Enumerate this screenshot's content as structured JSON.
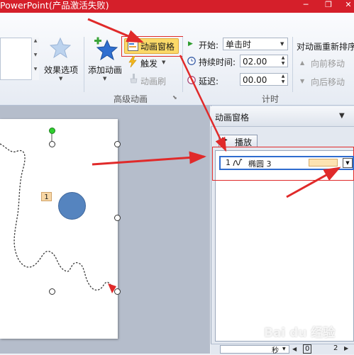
{
  "window": {
    "title": "PowerPoint(产品激活失败)",
    "minimize_glyph": "─",
    "restore_glyph": "❐",
    "close_glyph": "✕"
  },
  "ribbon": {
    "effect_options_label": "效果选项",
    "add_animation_label": "添加动画",
    "animation_pane_label": "动画窗格",
    "trigger_label": "触发",
    "animation_painter_label": "动画刷",
    "advanced_group_label": "高级动画",
    "start_label": "开始:",
    "start_value": "单击时",
    "duration_label": "持续时间:",
    "duration_value": "02.00",
    "delay_label": "延迟:",
    "delay_value": "00.00",
    "timing_group_label": "计时",
    "reorder_label": "对动画重新排序",
    "move_earlier_label": "向前移动",
    "move_later_label": "向后移动"
  },
  "slide": {
    "animation_tag": "1"
  },
  "pane": {
    "title": "动画窗格",
    "play_label": "播放",
    "items": [
      {
        "index": "1",
        "name": "椭圆 3"
      }
    ],
    "footer_seconds_label": "秒",
    "footer_ticks": [
      "0",
      "2"
    ]
  },
  "watermark": "Bai du 经验",
  "colors": {
    "title_bar": "#d51f2a",
    "highlight_button": "#fbd968",
    "annotation_red": "#e02a2a",
    "shape_fill": "#5584bf",
    "timing_bar": "#fde3b2",
    "selection_border": "#2f6ccf"
  },
  "icons": {
    "effect_options": "star-icon",
    "add_animation": "star-plus-icon",
    "animation_pane": "animation-pane-icon",
    "trigger": "lightning-icon",
    "animation_painter": "brush-icon",
    "start": "play-icon",
    "duration": "clock-icon",
    "delay": "clock-icon",
    "move_earlier": "triangle-up-icon",
    "move_later": "triangle-down-icon",
    "motion_path": "motion-path-icon",
    "play": "play-icon",
    "dropdown": "chevron-down-icon"
  }
}
